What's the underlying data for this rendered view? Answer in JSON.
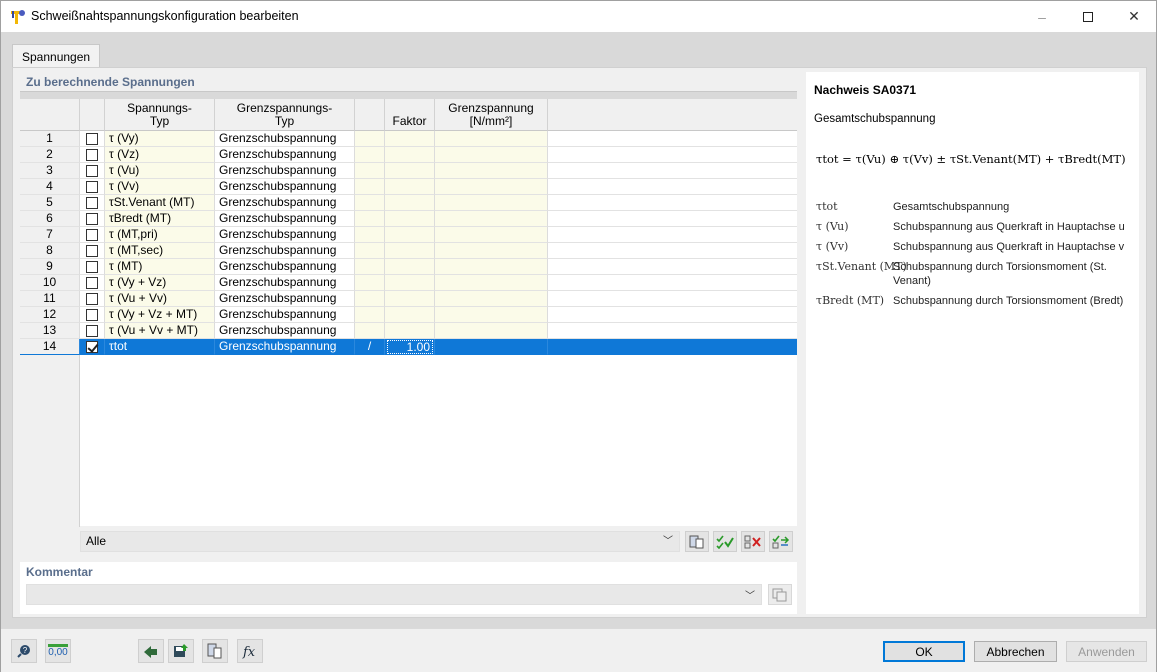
{
  "window": {
    "title": "Schweißnahtspannungskonfiguration bearbeiten",
    "minimize": "–",
    "close": "✕"
  },
  "tabs": [
    {
      "label": "Spannungen"
    }
  ],
  "stresses": {
    "section_title": "Zu berechnende Spannungen",
    "headers": {
      "typ": "Spannungs-\nTyp",
      "grenz": "Grenzspannungs-\nTyp",
      "faktor": "Faktor",
      "grenzspannung": "Grenzspannung\n[N/mm²]"
    },
    "rows": [
      {
        "no": "1",
        "checked": false,
        "typ": "τ (Vy)",
        "grenz": "Grenzschubspannung",
        "e1": "",
        "faktor": ""
      },
      {
        "no": "2",
        "checked": false,
        "typ": "τ (Vz)",
        "grenz": "Grenzschubspannung",
        "e1": "",
        "faktor": ""
      },
      {
        "no": "3",
        "checked": false,
        "typ": "τ (Vu)",
        "grenz": "Grenzschubspannung",
        "e1": "",
        "faktor": ""
      },
      {
        "no": "4",
        "checked": false,
        "typ": "τ (Vv)",
        "grenz": "Grenzschubspannung",
        "e1": "",
        "faktor": ""
      },
      {
        "no": "5",
        "checked": false,
        "typ": "τSt.Venant (MT)",
        "grenz": "Grenzschubspannung",
        "e1": "",
        "faktor": ""
      },
      {
        "no": "6",
        "checked": false,
        "typ": "τBredt (MT)",
        "grenz": "Grenzschubspannung",
        "e1": "",
        "faktor": ""
      },
      {
        "no": "7",
        "checked": false,
        "typ": "τ (MT,pri)",
        "grenz": "Grenzschubspannung",
        "e1": "",
        "faktor": ""
      },
      {
        "no": "8",
        "checked": false,
        "typ": "τ (MT,sec)",
        "grenz": "Grenzschubspannung",
        "e1": "",
        "faktor": ""
      },
      {
        "no": "9",
        "checked": false,
        "typ": "τ (MT)",
        "grenz": "Grenzschubspannung",
        "e1": "",
        "faktor": ""
      },
      {
        "no": "10",
        "checked": false,
        "typ": "τ (Vy + Vz)",
        "grenz": "Grenzschubspannung",
        "e1": "",
        "faktor": ""
      },
      {
        "no": "11",
        "checked": false,
        "typ": "τ (Vu + Vv)",
        "grenz": "Grenzschubspannung",
        "e1": "",
        "faktor": ""
      },
      {
        "no": "12",
        "checked": false,
        "typ": "τ (Vy + Vz + MT)",
        "grenz": "Grenzschubspannung",
        "e1": "",
        "faktor": ""
      },
      {
        "no": "13",
        "checked": false,
        "typ": "τ (Vu + Vv + MT)",
        "grenz": "Grenzschubspannung",
        "e1": "",
        "faktor": ""
      },
      {
        "no": "14",
        "checked": true,
        "typ": "τtot",
        "grenz": "Grenzschubspannung",
        "e1": "/",
        "faktor": "1.00",
        "selected": true
      }
    ],
    "filter_value": "Alle"
  },
  "comment": {
    "title": "Kommentar",
    "value": ""
  },
  "info": {
    "title": "Nachweis SA0371",
    "description": "Gesamtschubspannung",
    "formula": "τtot = τ(Vu) ⊕ τ(Vv) ± τSt.Venant(MT) + τBredt(MT)",
    "legend": [
      {
        "symbol": "τtot",
        "text": "Gesamtschubspannung"
      },
      {
        "symbol": "τ (Vu)",
        "text": "Schubspannung aus Querkraft in Hauptachse u"
      },
      {
        "symbol": "τ (Vv)",
        "text": "Schubspannung aus Querkraft in Hauptachse v"
      },
      {
        "symbol": "τSt.Venant (MT)",
        "text": "Schubspannung durch Torsionsmoment (St. Venant)"
      },
      {
        "symbol": "τBredt (MT)",
        "text": "Schubspannung durch Torsionsmoment (Bredt)"
      }
    ]
  },
  "footer": {
    "units_label": "0,00",
    "ok": "OK",
    "cancel": "Abbrechen",
    "apply": "Anwenden"
  },
  "colors": {
    "selection": "#0f78d7",
    "section_title": "#5a6e8c",
    "editable_cell": "#fbfbe9"
  }
}
